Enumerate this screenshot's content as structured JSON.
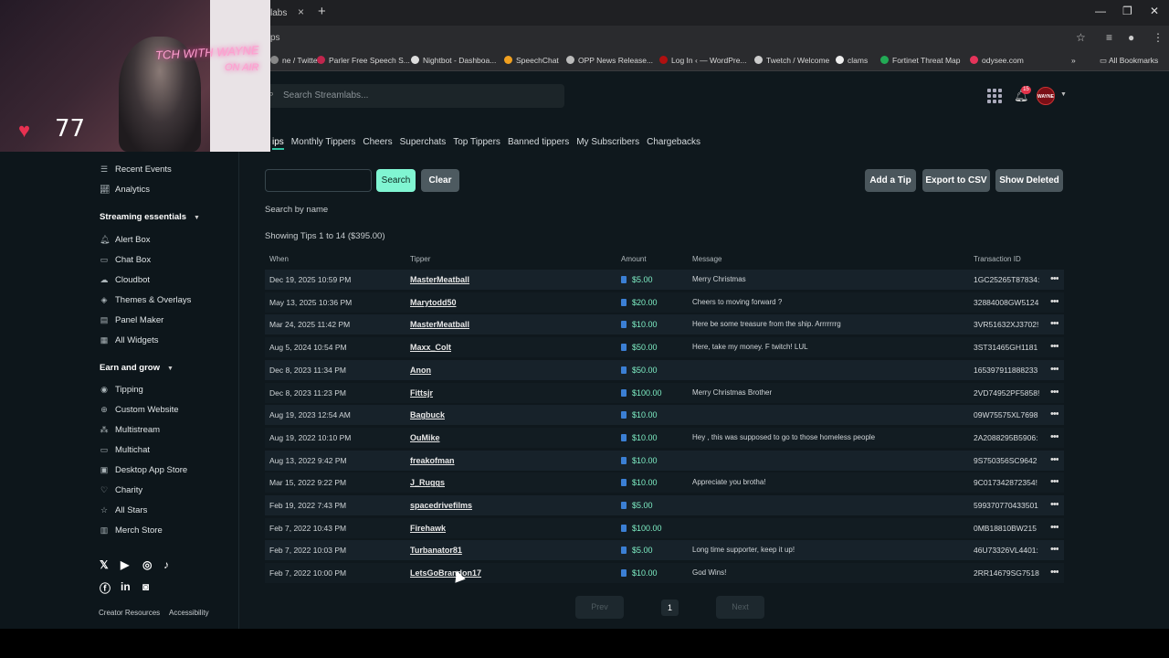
{
  "browser": {
    "tab_title": "labs",
    "url_fragment": "ps",
    "bookmarks": [
      {
        "label": "ne / Twitter",
        "color": "#888888"
      },
      {
        "label": "Parler Free Speech S...",
        "color": "#c0264d"
      },
      {
        "label": "Nightbot - Dashboa...",
        "color": "#dddddd"
      },
      {
        "label": "SpeechChat",
        "color": "#f0a020"
      },
      {
        "label": "OPP News Release...",
        "color": "#bbbbbb"
      },
      {
        "label": "Log In ‹ — WordPre...",
        "color": "#b01010"
      },
      {
        "label": "Twetch / Welcome",
        "color": "#cccccc"
      },
      {
        "label": "clams",
        "color": "#eeeeee"
      },
      {
        "label": "Fortinet Threat Map",
        "color": "#22aa55"
      },
      {
        "label": "odysee.com",
        "color": "#e5345a"
      }
    ],
    "all_bookmarks": "All Bookmarks"
  },
  "header": {
    "search_placeholder": "Search Streamlabs...",
    "notification_count": "15",
    "avatar_text": "WAYNE"
  },
  "tabs": [
    "ips",
    "Monthly Tippers",
    "Cheers",
    "Superchats",
    "Top Tippers",
    "Banned tippers",
    "My Subscribers",
    "Chargebacks"
  ],
  "filters": {
    "search_button": "Search",
    "clear_button": "Clear",
    "add_tip_button": "Add a Tip",
    "export_button": "Export to CSV",
    "show_deleted_button": "Show Deleted",
    "hint": "Search by name",
    "showing": "Showing Tips 1 to 14 ($395.00)"
  },
  "table": {
    "headers": {
      "when": "When",
      "tipper": "Tipper",
      "amount": "Amount",
      "message": "Message",
      "transaction": "Transaction ID"
    },
    "rows": [
      {
        "when": "Dec 19, 2025 10:59 PM",
        "tipper": "MasterMeatball",
        "amount": "$5.00",
        "message": "Merry Christmas",
        "txn": "1GC25265T87834:"
      },
      {
        "when": "May 13, 2025 10:36 PM",
        "tipper": "Marytodd50",
        "amount": "$20.00",
        "message": "Cheers to moving forward ?",
        "txn": "32884008GW5124"
      },
      {
        "when": "Mar 24, 2025 11:42 PM",
        "tipper": "MasterMeatball",
        "amount": "$10.00",
        "message": "Here be some treasure from the ship. Arrrrrrrg",
        "txn": "3VR51632XJ3702!"
      },
      {
        "when": "Aug 5, 2024 10:54 PM",
        "tipper": "Maxx_Colt",
        "amount": "$50.00",
        "message": "Here, take my money. F twitch! LUL",
        "txn": "3ST31465GH1181"
      },
      {
        "when": "Dec 8, 2023 11:34 PM",
        "tipper": "Anon",
        "amount": "$50.00",
        "message": "",
        "txn": "165397911888233"
      },
      {
        "when": "Dec 8, 2023 11:23 PM",
        "tipper": "Fittsjr",
        "amount": "$100.00",
        "message": "Merry Christmas Brother",
        "txn": "2VD74952PF5858!"
      },
      {
        "when": "Aug 19, 2023 12:54 AM",
        "tipper": "Bagbuck",
        "amount": "$10.00",
        "message": "",
        "txn": "09W75575XL7698"
      },
      {
        "when": "Aug 19, 2022 10:10 PM",
        "tipper": "OuMike",
        "amount": "$10.00",
        "message": "Hey , this was supposed to go to those homeless people",
        "txn": "2A2088295B5906:"
      },
      {
        "when": "Aug 13, 2022 9:42 PM",
        "tipper": "freakofman",
        "amount": "$10.00",
        "message": "",
        "txn": "9S750356SC9642"
      },
      {
        "when": "Mar 15, 2022 9:22 PM",
        "tipper": "J_Ruggs",
        "amount": "$10.00",
        "message": "Appreciate you brotha!",
        "txn": "9C017342872354!"
      },
      {
        "when": "Feb 19, 2022 7:43 PM",
        "tipper": "spacedrivefilms",
        "amount": "$5.00",
        "message": "",
        "txn": "599370770433501"
      },
      {
        "when": "Feb 7, 2022 10:43 PM",
        "tipper": "Firehawk",
        "amount": "$100.00",
        "message": "",
        "txn": "0MB18810BW215"
      },
      {
        "when": "Feb 7, 2022 10:03 PM",
        "tipper": "Turbanator81",
        "amount": "$5.00",
        "message": "Long time supporter, keep it up!",
        "txn": "46U73326VL4401:"
      },
      {
        "when": "Feb 7, 2022 10:00 PM",
        "tipper": "LetsGoBrandon17",
        "amount": "$10.00",
        "message": "God Wins!",
        "txn": "2RR14679SG7518"
      }
    ]
  },
  "pagination": {
    "prev": "Prev",
    "page": "1",
    "next": "Next"
  },
  "sidebar": {
    "top_items": [
      {
        "label": "Recent Events",
        "icon": "list-icon"
      },
      {
        "label": "Analytics",
        "icon": "chart-icon"
      }
    ],
    "streaming_heading": "Streaming essentials",
    "streaming_items": [
      {
        "label": "Alert Box",
        "icon": "bell-icon"
      },
      {
        "label": "Chat Box",
        "icon": "chat-icon"
      },
      {
        "label": "Cloudbot",
        "icon": "bot-icon"
      },
      {
        "label": "Themes & Overlays",
        "icon": "layers-icon"
      },
      {
        "label": "Panel Maker",
        "icon": "panel-icon"
      },
      {
        "label": "All Widgets",
        "icon": "grid-icon"
      }
    ],
    "earn_heading": "Earn and grow",
    "earn_items": [
      {
        "label": "Tipping",
        "icon": "coin-icon"
      },
      {
        "label": "Custom Website",
        "icon": "globe-icon"
      },
      {
        "label": "Multistream",
        "icon": "multistream-icon"
      },
      {
        "label": "Multichat",
        "icon": "multichat-icon"
      },
      {
        "label": "Desktop App Store",
        "icon": "store-icon"
      },
      {
        "label": "Charity",
        "icon": "heart-icon"
      },
      {
        "label": "All Stars",
        "icon": "star-icon"
      },
      {
        "label": "Merch Store",
        "icon": "shop-icon"
      }
    ],
    "footer": {
      "resources": "Creator Resources",
      "accessibility": "Accessibility"
    }
  },
  "webcam": {
    "heart_rate": "77",
    "neon_text": "TCH WITH WAYNE",
    "neon_text2": "ON AIR"
  },
  "colors": {
    "accent": "#80f5d2",
    "amount": "#7ff0c6",
    "background": "#0f181d"
  }
}
